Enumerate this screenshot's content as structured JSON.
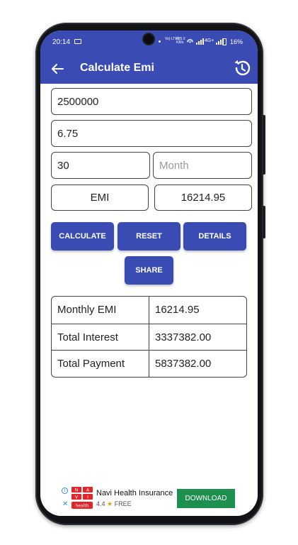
{
  "statusbar": {
    "time": "20:14",
    "volte_top": "Vo) LTE1",
    "speed_top": "455.0",
    "speed_unit": "KB/s",
    "network": "4G+",
    "battery": "16%"
  },
  "appbar": {
    "title": "Calculate Emi"
  },
  "form": {
    "principal": {
      "value": "2500000",
      "placeholder": ""
    },
    "rate": {
      "value": "6.75",
      "placeholder": ""
    },
    "tenure": {
      "value": "30",
      "placeholder": ""
    },
    "tenure_unit": {
      "value": "",
      "placeholder": "Month"
    },
    "emi_label": "EMI",
    "emi_value": "16214.95"
  },
  "buttons": {
    "calculate": "CALCULATE",
    "reset": "RESET",
    "details": "DETAILS",
    "share": "SHARE"
  },
  "result": {
    "rows": [
      {
        "label": "Monthly EMI",
        "value": "16214.95"
      },
      {
        "label": "Total Interest",
        "value": "3337382.00"
      },
      {
        "label": "Total Payment",
        "value": "5837382.00"
      }
    ]
  },
  "ad": {
    "app_name": "Navi Health Insurance",
    "rating": "4.4",
    "price": "FREE",
    "cta": "DOWNLOAD",
    "logo_lines": [
      "N",
      "A",
      "V",
      "I",
      "health"
    ]
  },
  "colors": {
    "primary": "#3a4cb4",
    "cta_green": "#1d8f4f",
    "logo_red": "#e3242b"
  }
}
